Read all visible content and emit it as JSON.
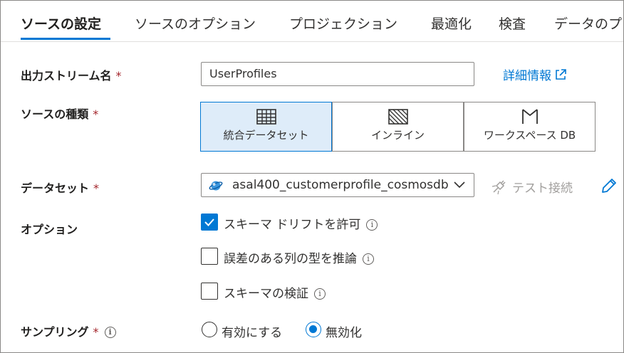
{
  "tabs": [
    {
      "label": "ソースの設定",
      "active": true
    },
    {
      "label": "ソースのオプション"
    },
    {
      "label": "プロジェクション"
    },
    {
      "label": "最適化"
    },
    {
      "label": "検査"
    },
    {
      "label": "データのプ"
    }
  ],
  "required_mark": "*",
  "output_stream": {
    "label": "出力ストリーム名",
    "value": "UserProfiles",
    "learn_more": "詳細情報",
    "learn_more_icon": "external-link-icon"
  },
  "source_type": {
    "label": "ソースの種類",
    "options": [
      {
        "label": "統合データセット",
        "icon": "table-grid-icon",
        "selected": true
      },
      {
        "label": "インライン",
        "icon": "inline-hatch-icon"
      },
      {
        "label": "ワークスペース DB",
        "icon": "workspace-db-icon"
      }
    ]
  },
  "dataset": {
    "label": "データセット",
    "value": "asal400_customerprofile_cosmosdb",
    "icon": "cosmosdb-icon",
    "test_connection": "テスト接続",
    "edit_icon": "pencil-icon"
  },
  "options": {
    "label": "オプション",
    "items": [
      {
        "label": "スキーマ ドリフトを許可",
        "checked": true
      },
      {
        "label": "誤差のある列の型を推論",
        "checked": false
      },
      {
        "label": "スキーマの検証",
        "checked": false
      }
    ]
  },
  "sampling": {
    "label": "サンプリング",
    "choices": [
      {
        "label": "有効にする",
        "selected": false
      },
      {
        "label": "無効化",
        "selected": true
      }
    ]
  },
  "colors": {
    "accent": "#0078d4",
    "required": "#a4262c",
    "selected_card_bg": "#deecf9"
  }
}
